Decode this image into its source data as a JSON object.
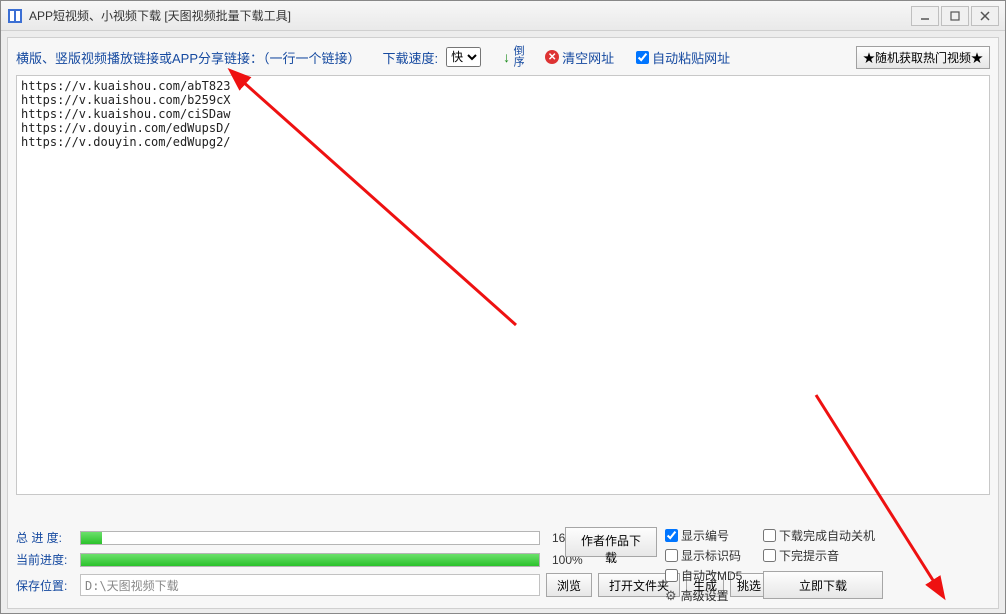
{
  "titlebar": {
    "title": "APP短视频、小视频下载 [天图视频批量下载工具]"
  },
  "toolbar": {
    "label_main": "横版、竖版视频播放链接或APP分享链接：（一行一个链接）",
    "speed_label": "下载速度:",
    "speed_value": "快",
    "reverse": "倒序",
    "clear": "清空网址",
    "auto_paste": "自动粘贴网址",
    "random_hot": "★随机获取热门视频★"
  },
  "urls_text": "https://v.kuaishou.com/abT823\nhttps://v.kuaishou.com/b259cX\nhttps://v.kuaishou.com/ciSDaw\nhttps://v.douyin.com/edWupsD/\nhttps://v.douyin.com/edWupg2/",
  "progress": {
    "total_label": "总 进 度:",
    "total_pct": 4.5,
    "total_text": "16 / 354",
    "current_label": "当前进度:",
    "current_pct": 100,
    "current_text": "100%"
  },
  "save": {
    "label": "保存位置:",
    "path": "D:\\天图视频下载",
    "browse": "浏览",
    "open_folder": "打开文件夹",
    "generate": "生成",
    "pick": "挑选"
  },
  "right": {
    "author_works": "作者作品下载",
    "show_index": "显示编号",
    "show_id": "显示标识码",
    "auto_md5": "自动改MD5",
    "advanced": "高级设置",
    "shutdown": "下载完成自动关机",
    "beep": "下完提示音",
    "download_now": "立即下载"
  }
}
